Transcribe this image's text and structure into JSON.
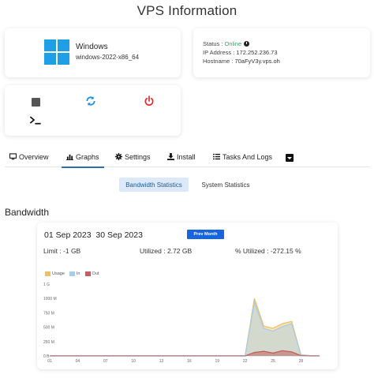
{
  "page": {
    "title": "VPS Information"
  },
  "os": {
    "name": "Windows",
    "version": "windows-2022-x86_64"
  },
  "status": {
    "status_label": "Status : ",
    "status_value": "Online",
    "ip_label": "IP Address : ",
    "ip_value": "172.252.236.73",
    "hostname_label": "Hostname : ",
    "hostname_value": "70aFyV3y.vps.oh",
    "online_color": "#27ae60"
  },
  "power": {
    "icons": [
      "stop-icon",
      "restart-icon",
      "power-icon",
      "console-icon"
    ],
    "restart_color": "#1e8fe0",
    "power_color": "#e03030"
  },
  "tabs": [
    {
      "label": "Overview",
      "icon": "monitor-icon"
    },
    {
      "label": "Graphs",
      "icon": "bar-chart-icon",
      "active": true
    },
    {
      "label": "Settings",
      "icon": "gear-icon"
    },
    {
      "label": "Install",
      "icon": "download-icon"
    },
    {
      "label": "Tasks And Logs",
      "icon": "list-icon"
    }
  ],
  "subtabs": {
    "bandwidth": "Bandwidth Statistics",
    "system": "System Statistics"
  },
  "bandwidth": {
    "section_title": "Bandwidth",
    "date_range": "01 Sep 2023  30 Sep 2023",
    "prev_month": "Prev Month",
    "limit": "Limit : -1 GB",
    "utilized": "Utilized : 2.72 GB",
    "pct_utilized": "% Utilized : -272.15 %"
  },
  "chart_data": {
    "type": "area",
    "x": [
      1,
      2,
      3,
      4,
      5,
      6,
      7,
      8,
      9,
      10,
      11,
      12,
      13,
      14,
      15,
      16,
      17,
      18,
      19,
      20,
      21,
      22,
      23,
      24,
      25,
      26,
      27,
      28,
      29,
      30
    ],
    "x_tick_labels": [
      "01",
      "04",
      "07",
      "10",
      "13",
      "16",
      "19",
      "22",
      "25",
      "28"
    ],
    "x_tick_positions": [
      1,
      4,
      7,
      10,
      13,
      16,
      19,
      22,
      25,
      28
    ],
    "y_tick_labels": [
      "0 B",
      "250 M",
      "500 M",
      "750 M",
      "1000 M",
      "1 G"
    ],
    "y_tick_values": [
      0,
      250,
      500,
      750,
      1000,
      1250
    ],
    "ylim": [
      0,
      1250
    ],
    "xlim": [
      1,
      30
    ],
    "legend": [
      "Usage",
      "In",
      "Out"
    ],
    "colors": {
      "Usage": "#f0c060",
      "In": "#a8cce8",
      "Out": "#c06060"
    },
    "series": [
      {
        "name": "Usage",
        "values": [
          5,
          5,
          5,
          5,
          5,
          5,
          5,
          5,
          5,
          5,
          5,
          5,
          5,
          5,
          5,
          5,
          5,
          5,
          5,
          5,
          5,
          5,
          1000,
          520,
          480,
          560,
          600,
          20,
          5,
          5
        ]
      },
      {
        "name": "In",
        "values": [
          5,
          5,
          5,
          5,
          5,
          5,
          5,
          5,
          5,
          5,
          5,
          5,
          5,
          5,
          5,
          5,
          5,
          5,
          5,
          5,
          5,
          5,
          940,
          480,
          430,
          510,
          560,
          15,
          5,
          5
        ]
      },
      {
        "name": "Out",
        "values": [
          0,
          0,
          0,
          0,
          0,
          0,
          0,
          0,
          0,
          0,
          0,
          0,
          0,
          0,
          0,
          0,
          0,
          0,
          0,
          0,
          0,
          0,
          60,
          80,
          50,
          90,
          70,
          5,
          0,
          0
        ]
      }
    ]
  }
}
